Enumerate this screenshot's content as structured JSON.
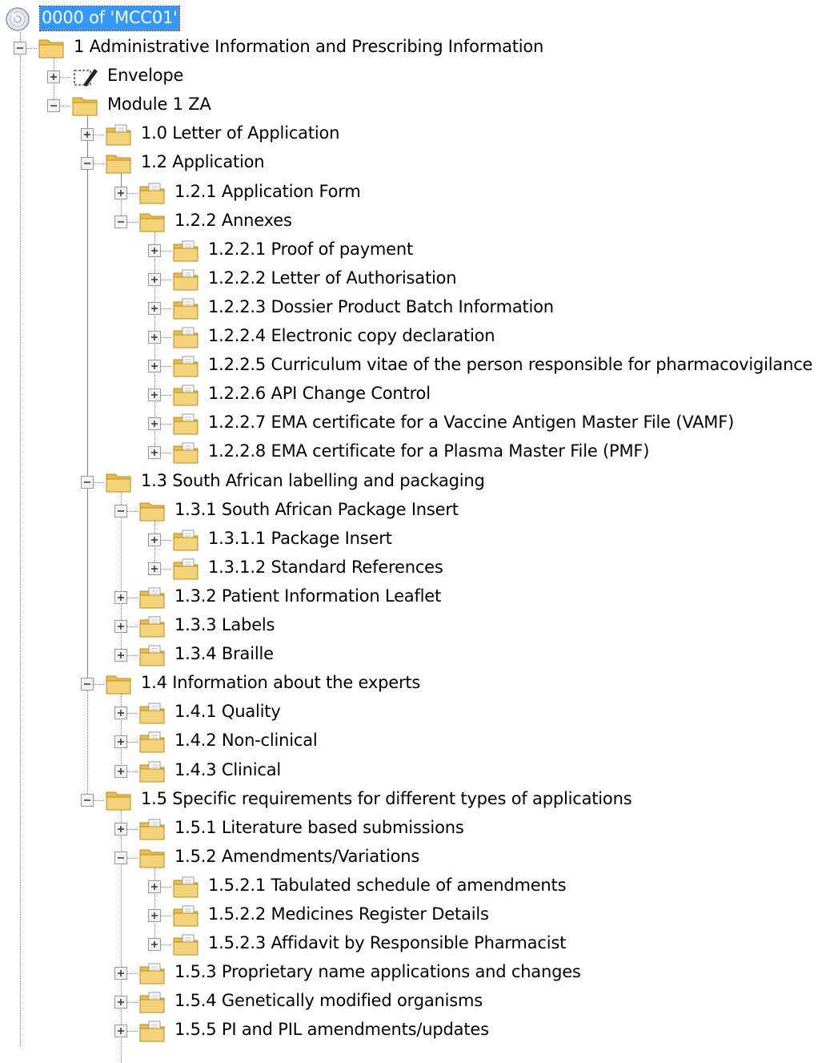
{
  "root": {
    "label": "0000 of 'MCC01'",
    "icon": "cd-disc-icon",
    "selected": true
  },
  "items": [
    {
      "label": "1 Administrative Information and Prescribing Information",
      "level": 1,
      "expanded": true,
      "icon": "folder-icon"
    },
    {
      "label": "Envelope",
      "level": 2,
      "expanded": false,
      "icon": "envelope-edit-icon"
    },
    {
      "label": "Module 1 ZA",
      "level": 2,
      "expanded": true,
      "icon": "folder-icon"
    },
    {
      "label": "1.0 Letter of Application",
      "level": 3,
      "expanded": false,
      "icon": "folder-doc-icon"
    },
    {
      "label": "1.2 Application",
      "level": 3,
      "expanded": true,
      "icon": "folder-icon"
    },
    {
      "label": "1.2.1 Application Form",
      "level": 4,
      "expanded": false,
      "icon": "folder-doc-icon"
    },
    {
      "label": "1.2.2 Annexes",
      "level": 4,
      "expanded": true,
      "icon": "folder-icon"
    },
    {
      "label": "1.2.2.1 Proof of payment",
      "level": 5,
      "expanded": false,
      "icon": "folder-doc-icon"
    },
    {
      "label": "1.2.2.2 Letter of Authorisation",
      "level": 5,
      "expanded": false,
      "icon": "folder-doc-icon"
    },
    {
      "label": "1.2.2.3 Dossier Product Batch Information",
      "level": 5,
      "expanded": false,
      "icon": "folder-doc-icon"
    },
    {
      "label": "1.2.2.4 Electronic copy declaration",
      "level": 5,
      "expanded": false,
      "icon": "folder-doc-icon"
    },
    {
      "label": "1.2.2.5 Curriculum vitae of the person responsible for pharmacovigilance",
      "level": 5,
      "expanded": false,
      "icon": "folder-doc-icon"
    },
    {
      "label": "1.2.2.6 API Change Control",
      "level": 5,
      "expanded": false,
      "icon": "folder-doc-icon"
    },
    {
      "label": "1.2.2.7 EMA certificate for a Vaccine Antigen Master File (VAMF)",
      "level": 5,
      "expanded": false,
      "icon": "folder-doc-icon"
    },
    {
      "label": "1.2.2.8 EMA certificate for a Plasma Master File (PMF)",
      "level": 5,
      "expanded": false,
      "icon": "folder-doc-icon"
    },
    {
      "label": "1.3 South African labelling and packaging",
      "level": 3,
      "expanded": true,
      "icon": "folder-icon"
    },
    {
      "label": "1.3.1 South African Package Insert",
      "level": 4,
      "expanded": true,
      "icon": "folder-icon"
    },
    {
      "label": "1.3.1.1 Package Insert",
      "level": 5,
      "expanded": false,
      "icon": "folder-doc-icon"
    },
    {
      "label": "1.3.1.2 Standard References",
      "level": 5,
      "expanded": false,
      "icon": "folder-doc-icon"
    },
    {
      "label": "1.3.2 Patient Information Leaflet",
      "level": 4,
      "expanded": false,
      "icon": "folder-doc-icon"
    },
    {
      "label": "1.3.3 Labels",
      "level": 4,
      "expanded": false,
      "icon": "folder-doc-icon"
    },
    {
      "label": "1.3.4 Braille",
      "level": 4,
      "expanded": false,
      "icon": "folder-doc-icon"
    },
    {
      "label": "1.4 Information about the experts",
      "level": 3,
      "expanded": true,
      "icon": "folder-icon"
    },
    {
      "label": "1.4.1 Quality",
      "level": 4,
      "expanded": false,
      "icon": "folder-doc-icon"
    },
    {
      "label": "1.4.2 Non-clinical",
      "level": 4,
      "expanded": false,
      "icon": "folder-doc-icon"
    },
    {
      "label": "1.4.3 Clinical",
      "level": 4,
      "expanded": false,
      "icon": "folder-doc-icon"
    },
    {
      "label": "1.5 Specific requirements for different types of applications",
      "level": 3,
      "expanded": true,
      "icon": "folder-icon"
    },
    {
      "label": "1.5.1 Literature based submissions",
      "level": 4,
      "expanded": false,
      "icon": "folder-doc-icon"
    },
    {
      "label": "1.5.2 Amendments/Variations",
      "level": 4,
      "expanded": true,
      "icon": "folder-icon"
    },
    {
      "label": "1.5.2.1 Tabulated schedule of amendments",
      "level": 5,
      "expanded": false,
      "icon": "folder-doc-icon"
    },
    {
      "label": "1.5.2.2 Medicines Register Details",
      "level": 5,
      "expanded": false,
      "icon": "folder-doc-icon"
    },
    {
      "label": "1.5.2.3 Affidavit by Responsible Pharmacist",
      "level": 5,
      "expanded": false,
      "icon": "folder-doc-icon"
    },
    {
      "label": "1.5.3 Proprietary name applications and changes",
      "level": 4,
      "expanded": false,
      "icon": "folder-doc-icon"
    },
    {
      "label": "1.5.4 Genetically modified organisms",
      "level": 4,
      "expanded": false,
      "icon": "folder-doc-icon"
    },
    {
      "label": "1.5.5 PI and PIL amendments/updates",
      "level": 4,
      "expanded": false,
      "icon": "folder-doc-icon"
    }
  ],
  "colors": {
    "selection": "#3399ff",
    "folder": "#f5d37a",
    "connector": "#808080"
  }
}
